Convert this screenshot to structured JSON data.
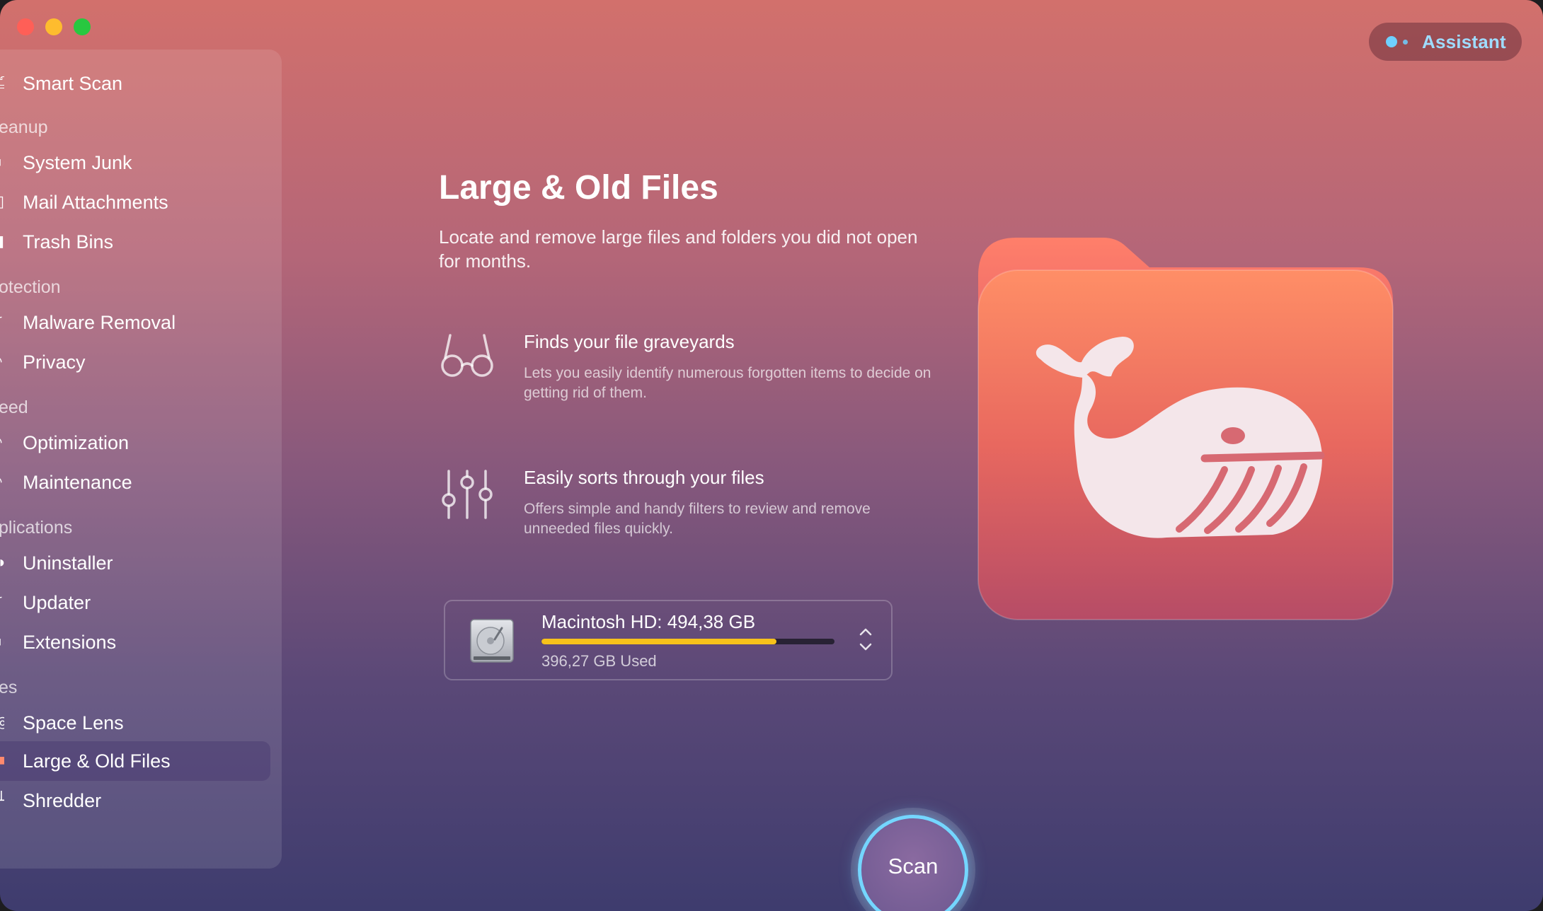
{
  "window": {
    "controls": [
      "close",
      "minimize",
      "zoom"
    ]
  },
  "assistant": {
    "label": "Assistant",
    "accent_color": "#6fd0ff"
  },
  "sidebar": {
    "active_item": "Large & Old Files",
    "sections": [
      {
        "header": "",
        "items": [
          {
            "label": "Smart Scan",
            "icon": "smart-scan-icon"
          }
        ]
      },
      {
        "header": "eanup",
        "items": [
          {
            "label": "System Junk",
            "icon": "system-junk-icon"
          },
          {
            "label": "Mail Attachments",
            "icon": "mail-icon"
          },
          {
            "label": "Trash Bins",
            "icon": "trash-icon"
          }
        ]
      },
      {
        "header": "otection",
        "items": [
          {
            "label": "Malware Removal",
            "icon": "malware-icon"
          },
          {
            "label": "Privacy",
            "icon": "privacy-icon"
          }
        ]
      },
      {
        "header": "eed",
        "items": [
          {
            "label": "Optimization",
            "icon": "optimization-icon"
          },
          {
            "label": "Maintenance",
            "icon": "maintenance-icon"
          }
        ]
      },
      {
        "header": "plications",
        "items": [
          {
            "label": "Uninstaller",
            "icon": "uninstaller-icon"
          },
          {
            "label": "Updater",
            "icon": "updater-icon"
          },
          {
            "label": "Extensions",
            "icon": "extensions-icon"
          }
        ]
      },
      {
        "header": "es",
        "items": [
          {
            "label": "Space Lens",
            "icon": "space-lens-icon"
          },
          {
            "label": "Large & Old Files",
            "icon": "large-old-files-icon"
          },
          {
            "label": "Shredder",
            "icon": "shredder-icon"
          }
        ]
      }
    ]
  },
  "main": {
    "title": "Large & Old Files",
    "description": "Locate and remove large files and folders you did not open for months.",
    "features": [
      {
        "icon": "glasses-icon",
        "title": "Finds your file graveyards",
        "description": "Lets you easily identify numerous forgotten items to decide on getting rid of them."
      },
      {
        "icon": "sliders-icon",
        "title": "Easily sorts through your files",
        "description": "Offers simple and handy filters to review and remove unneeded files quickly."
      }
    ],
    "disk": {
      "icon": "hard-drive-icon",
      "name": "Macintosh HD: 494,38 GB",
      "used_label": "396,27 GB Used",
      "used_fraction": 0.8015,
      "bar_color": "#f7c21b"
    },
    "illustration": "whale-folder-icon",
    "scan_button": {
      "label": "Scan",
      "ring_color": "#74d6ff"
    }
  }
}
